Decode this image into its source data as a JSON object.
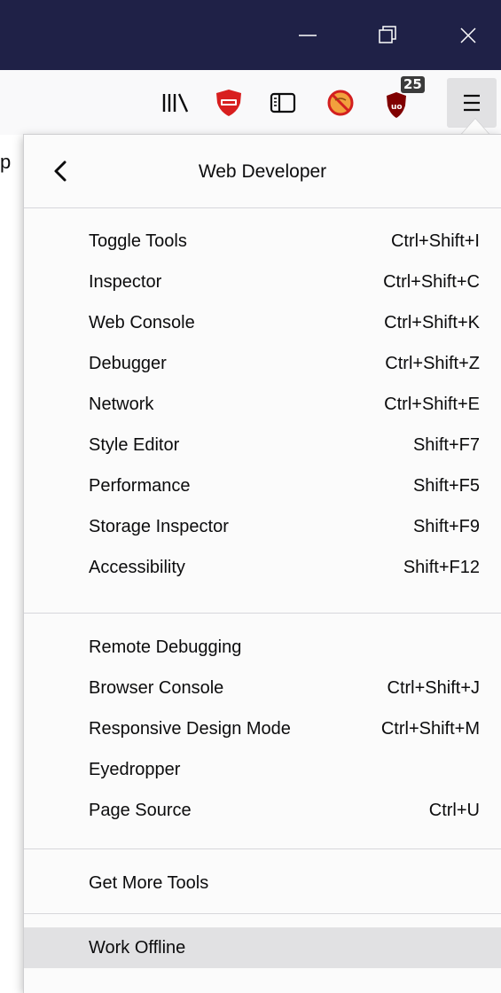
{
  "panel": {
    "title": "Web Developer",
    "groups": [
      [
        {
          "label": "Toggle Tools",
          "shortcut": "Ctrl+Shift+I"
        },
        {
          "label": "Inspector",
          "shortcut": "Ctrl+Shift+C"
        },
        {
          "label": "Web Console",
          "shortcut": "Ctrl+Shift+K"
        },
        {
          "label": "Debugger",
          "shortcut": "Ctrl+Shift+Z"
        },
        {
          "label": "Network",
          "shortcut": "Ctrl+Shift+E"
        },
        {
          "label": "Style Editor",
          "shortcut": "Shift+F7"
        },
        {
          "label": "Performance",
          "shortcut": "Shift+F5"
        },
        {
          "label": "Storage Inspector",
          "shortcut": "Shift+F9"
        },
        {
          "label": "Accessibility",
          "shortcut": "Shift+F12"
        }
      ],
      [
        {
          "label": "Remote Debugging",
          "shortcut": ""
        },
        {
          "label": "Browser Console",
          "shortcut": "Ctrl+Shift+J"
        },
        {
          "label": "Responsive Design Mode",
          "shortcut": "Ctrl+Shift+M"
        },
        {
          "label": "Eyedropper",
          "shortcut": ""
        },
        {
          "label": "Page Source",
          "shortcut": "Ctrl+U"
        }
      ],
      [
        {
          "label": "Get More Tools",
          "shortcut": ""
        }
      ],
      [
        {
          "label": "Work Offline",
          "shortcut": ""
        }
      ]
    ]
  },
  "toolbar": {
    "ublock_badge": "25",
    "icons": [
      "library-icon",
      "privacy-badger-icon",
      "sidebar-icon",
      "noscript-icon",
      "ublock-origin-icon",
      "hamburger-menu-icon"
    ]
  },
  "window_controls": [
    "minimize-icon",
    "restore-icon",
    "close-icon"
  ],
  "page": {
    "visible_letter": "p"
  },
  "colors": {
    "titlebar": "#1f2147",
    "toolbar": "#f9f9fa",
    "panel": "#fbfbfb",
    "hover": "#e1e1e3",
    "ublock_red": "#800000",
    "badger_red": "#d81f1f"
  }
}
